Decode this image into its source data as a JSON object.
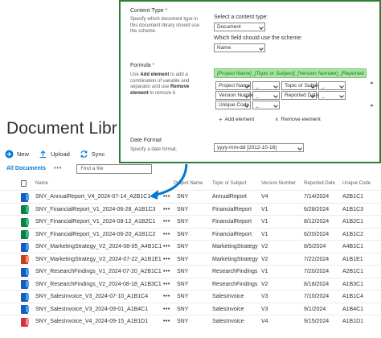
{
  "library": {
    "title": "Document Library",
    "commands": [
      {
        "label": "New",
        "icon": "plus-circle-icon"
      },
      {
        "label": "Upload",
        "icon": "upload-icon"
      },
      {
        "label": "Sync",
        "icon": "sync-icon"
      }
    ],
    "view_name": "All Documents",
    "view_more": "•••",
    "find_placeholder": "Find a file",
    "columns": {
      "name": "Name",
      "project": "Project Name",
      "topic": "Topic or Subject",
      "version": "Version Number",
      "date": "Reported Date",
      "code": "Unique Code"
    },
    "rows": [
      {
        "name": "SNY_AnnualReport_V4_2024-07-14_A2B1C1",
        "type": "docx",
        "project": "SNY",
        "topic": "AnnualReport",
        "version": "V4",
        "date": "7/14/2024",
        "code": "A2B1C1"
      },
      {
        "name": "SNY_FinancialReport_V1_2024-06-28_A1B1C3",
        "type": "xlsx",
        "project": "SNY",
        "topic": "FinancialReport",
        "version": "V1",
        "date": "6/28/2024",
        "code": "A1B1C3"
      },
      {
        "name": "SNY_FinancialReport_V1_2024-08-12_A1B2C1",
        "type": "xlsx",
        "project": "SNY",
        "topic": "FinancialReport",
        "version": "V1",
        "date": "8/12/2024",
        "code": "A1B2C1"
      },
      {
        "name": "SNY_FinancialReport_V1_2024-06-20_A1B1C2",
        "type": "xlsx",
        "project": "SNY",
        "topic": "FinancialReport",
        "version": "V1",
        "date": "6/20/2024",
        "code": "A1B1C2"
      },
      {
        "name": "SNY_MarketingStrategy_V2_2024-08-05_A4B1C1",
        "type": "docx",
        "project": "SNY",
        "topic": "MarketingStrategy",
        "version": "V2",
        "date": "8/5/2024",
        "code": "A4B1C1"
      },
      {
        "name": "SNY_MarketingStrategy_V2_2024-07-22_A1B1E1",
        "type": "pptx",
        "project": "SNY",
        "topic": "MarketingStrategy",
        "version": "V2",
        "date": "7/22/2024",
        "code": "A1B1E1"
      },
      {
        "name": "SNY_ResearchFindings_V1_2024-07-20_A2B1C1",
        "type": "docx",
        "project": "SNY",
        "topic": "ResearchFindings",
        "version": "V1",
        "date": "7/20/2024",
        "code": "A2B1C1"
      },
      {
        "name": "SNY_ResearchFindings_V2_2024-08-18_A1B3C1",
        "type": "docx",
        "project": "SNY",
        "topic": "ResearchFindings",
        "version": "V2",
        "date": "8/18/2024",
        "code": "A1B3C1"
      },
      {
        "name": "SNY_SalesInvoice_V3_2024-07-10_A1B1C4",
        "type": "docx",
        "project": "SNY",
        "topic": "SalesInvoice",
        "version": "V3",
        "date": "7/10/2024",
        "code": "A1B1C4"
      },
      {
        "name": "SNY_SalesInvoice_V3_2024-09-01_A1B4C1",
        "type": "docx",
        "project": "SNY",
        "topic": "SalesInvoice",
        "version": "V3",
        "date": "9/1/2024",
        "code": "A1B4C1"
      },
      {
        "name": "SNY_SalesInvoice_V4_2024-09-15_A1B1D1",
        "type": "pdf",
        "project": "SNY",
        "topic": "SalesInvoice",
        "version": "V4",
        "date": "9/15/2024",
        "code": "A1B1D1"
      }
    ]
  },
  "panel": {
    "content_type": {
      "label": "Content Type",
      "required_mark": "*",
      "description": "Specify which document type in this document library should use the scheme.",
      "select_label": "Select a content type:",
      "select_value": "Document",
      "field_label": "Which field should use the scheme:",
      "field_value": "Name"
    },
    "formula": {
      "label": "Formula",
      "required_mark": "*",
      "desc_pre": "Use ",
      "desc_add": "Add element",
      "desc_mid": " to add a combination of variable and separator and use ",
      "desc_remove": "Remove element",
      "desc_post": " to remove it.",
      "value": "[Project Name]_[Topic or Subject]_[Version Number]_[Reported D",
      "elements": [
        [
          "Project Name",
          "_",
          "Topic or Subject",
          "_"
        ],
        [
          "Version Number",
          "_",
          "Reported Date",
          "_"
        ],
        [
          "Unique Code",
          "_"
        ]
      ],
      "add_label": "Add element",
      "remove_label": "Remove element"
    },
    "date_format": {
      "label": "Date Format",
      "description": "Specify a date format.",
      "value": "yyyy-mm-dd [2012-10-16]"
    }
  },
  "colors": {
    "accent": "#0078d4",
    "panel_border": "#2e7d32",
    "formula_bg": "#a9e6a4",
    "arrow": "#0078d4"
  }
}
